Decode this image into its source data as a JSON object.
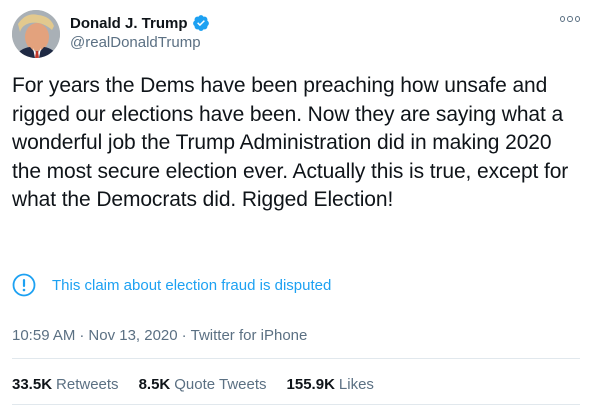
{
  "author": {
    "name": "Donald J. Trump",
    "handle": "@realDonaldTrump",
    "verified": true
  },
  "tweet": {
    "text": "For years the Dems have been preaching how unsafe and rigged our elections have been. Now they are saying what a wonderful job the Trump Administration did in making 2020 the most secure election ever. Actually this is true, except for what the Democrats did. Rigged Election!"
  },
  "notice": {
    "text": "This claim about election fraud is disputed",
    "icon": "exclamation-circle-icon"
  },
  "meta": {
    "time": "10:59 AM",
    "separator": "·",
    "date": "Nov 13, 2020",
    "source": "Twitter for iPhone"
  },
  "stats": {
    "retweets": {
      "count": "33.5K",
      "label": "Retweets"
    },
    "quote_tweets": {
      "count": "8.5K",
      "label": "Quote Tweets"
    },
    "likes": {
      "count": "155.9K",
      "label": "Likes"
    }
  },
  "colors": {
    "text": "#0f1419",
    "secondary": "#5b7083",
    "accent": "#1da1f2",
    "divider": "#e1e8ed"
  }
}
